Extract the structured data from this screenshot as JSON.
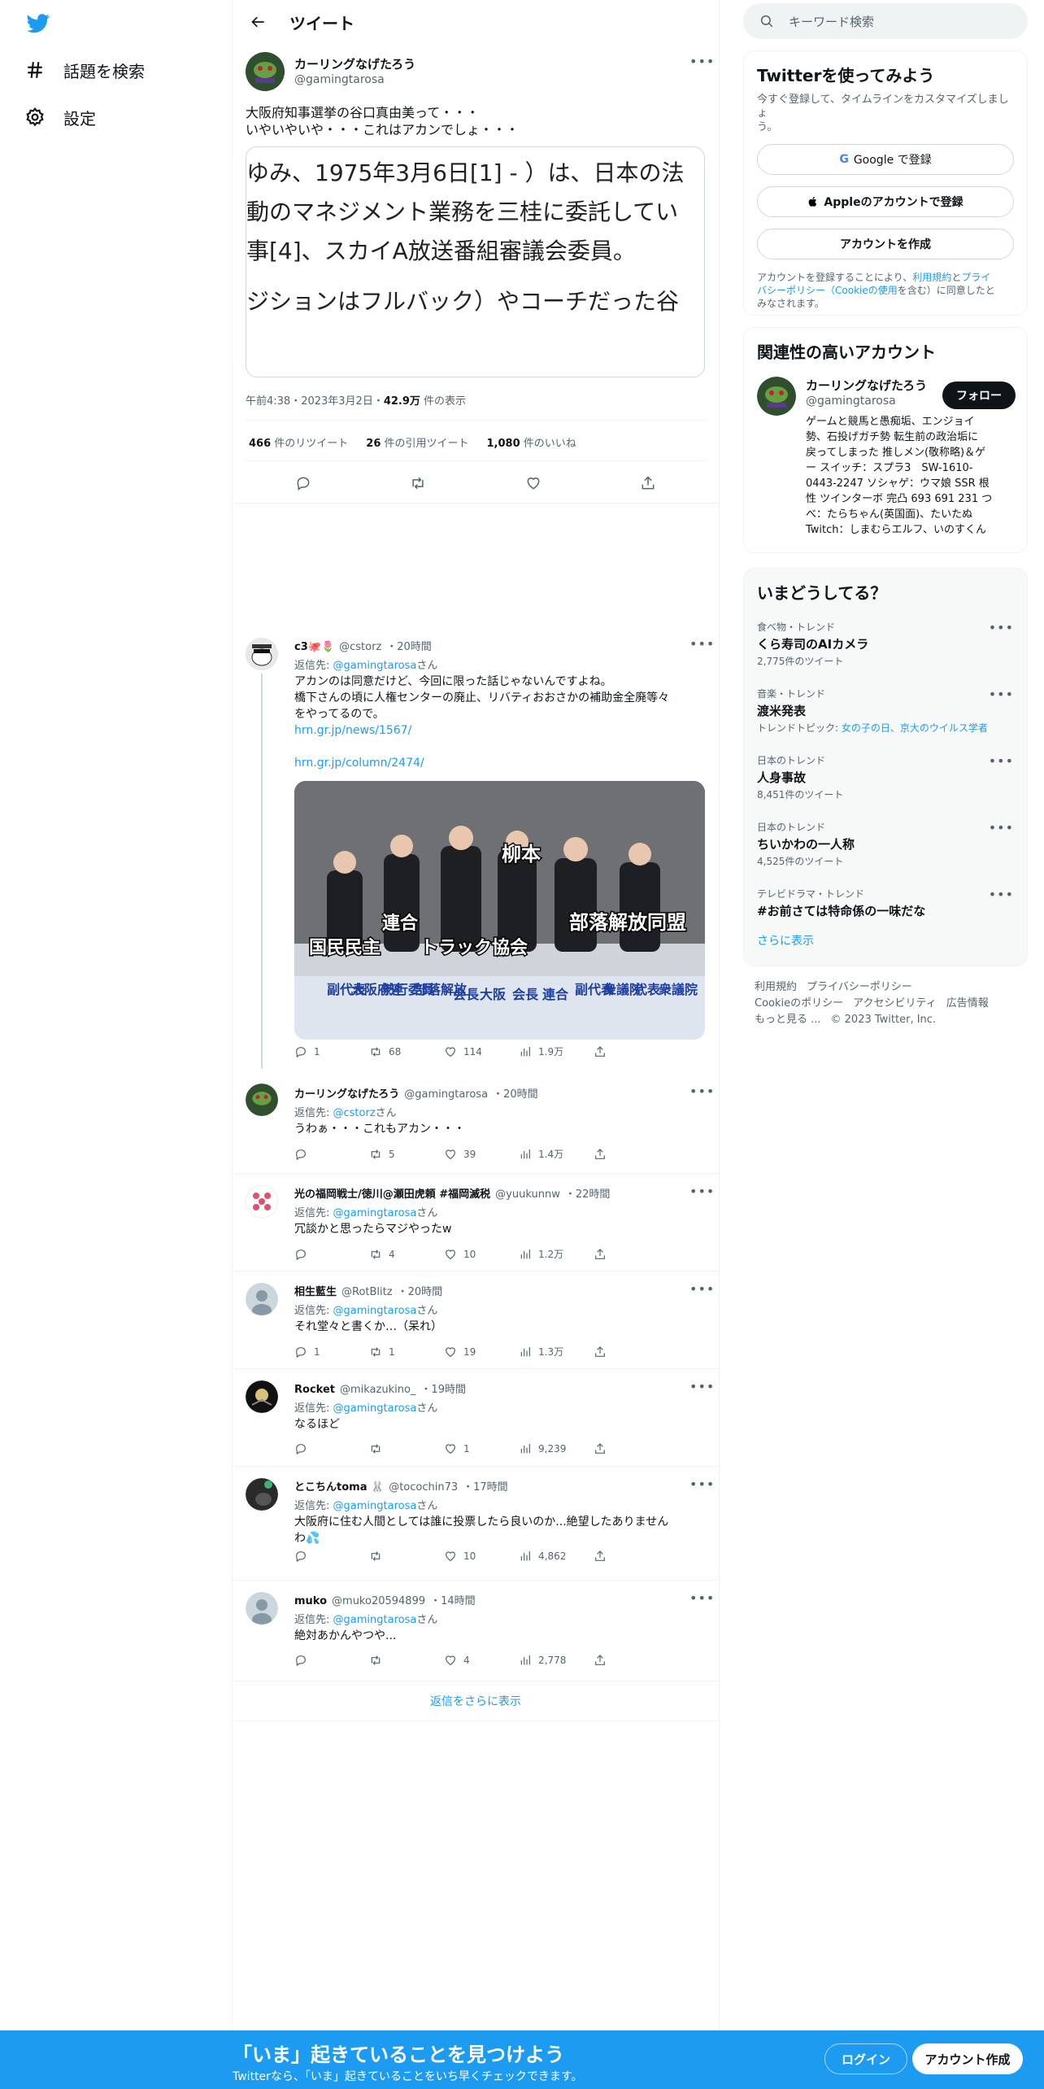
{
  "nav": {
    "explore": "話題を検索",
    "settings": "設定"
  },
  "header": {
    "title": "ツイート"
  },
  "main_tweet": {
    "name": "カーリングなげたろう",
    "handle": "@gamingtarosa",
    "text1": "大阪府知事選挙の谷口真由美って・・・",
    "text2": "いやいやいや・・・これはアカンでしょ・・・",
    "image_lines": [
      "ゆみ、1975年3月6日[1] - ）は、日本の法",
      "動のマネジメント業務を三桂に委託してい",
      "事[4]、スカイA放送番組審議会委員。",
      "ジションはフルバック）やコーチだった谷"
    ],
    "time": "午前4:38・2023年3月2日・",
    "views": "42.9万",
    "views_label": " 件の表示",
    "retweets": "466",
    "retweets_label": " 件のリツイート",
    "quotes": "26",
    "quotes_label": " 件の引用ツイート",
    "likes": "1,080",
    "likes_label": " 件のいいね"
  },
  "replies": [
    {
      "name": "c3🐙🌷",
      "handle": "@cstorz",
      "time": "・20時間",
      "to_label": "返信先: ",
      "to": "@gamingtarosa",
      "to_suffix": "さん",
      "lines": [
        "アカンのは同意だけど、今回に限った話じゃないんですよね。",
        "橋下さんの頃に人権センターの廃止、リバティおおさかの補助金全廃等々",
        "をやってるので。"
      ],
      "link1": "hrn.gr.jp/news/1567/",
      "link2": "hrn.gr.jp/column/2474/",
      "image_labels": [
        "柳本",
        "連合",
        "部落解放同盟",
        "国民民主",
        "トラック協会"
      ],
      "sign_texts": [
        "副代表",
        "大阪府連",
        "熱行委員",
        "部落解放",
        "会長",
        "大阪",
        "会長",
        "連合",
        "副代表",
        "衆議院",
        "代表",
        "衆議院"
      ],
      "reply_count": "1",
      "rt": "68",
      "like": "114",
      "views": "1.9万"
    },
    {
      "name": "カーリングなげたろう",
      "handle": "@gamingtarosa",
      "time": "・20時間",
      "to_label": "返信先: ",
      "to": "@cstorz",
      "to_suffix": "さん",
      "text": "うわぁ・・・これもアカン・・・",
      "reply_count": "",
      "rt": "5",
      "like": "39",
      "views": "1.4万"
    },
    {
      "name": "光の福岡戦士/徳川@瀬田虎頼 #福岡滅税",
      "handle": "@yuukunnw",
      "time": "・22時間",
      "to_label": "返信先: ",
      "to": "@gamingtarosa",
      "to_suffix": "さん",
      "text": "冗談かと思ったらマジやったw",
      "reply_count": "",
      "rt": "4",
      "like": "10",
      "views": "1.2万"
    },
    {
      "name": "相生藍生",
      "handle": "@RotBlitz",
      "time": "・20時間",
      "to_label": "返信先: ",
      "to": "@gamingtarosa",
      "to_suffix": "さん",
      "text": "それ堂々と書くか…（呆れ）",
      "reply_count": "1",
      "rt": "1",
      "like": "19",
      "views": "1.3万"
    },
    {
      "name": "Rocket",
      "handle": "@mikazukino_",
      "time": "・19時間",
      "to_label": "返信先: ",
      "to": "@gamingtarosa",
      "to_suffix": "さん",
      "text": "なるほど",
      "reply_count": "",
      "rt": "",
      "like": "1",
      "views": "9,239"
    },
    {
      "name": "とこちんtoma 🐰",
      "handle": "@tocochin73",
      "time": "・17時間",
      "to_label": "返信先: ",
      "to": "@gamingtarosa",
      "to_suffix": "さん",
      "text": "大阪府に住む人間としては誰に投票したら良いのか...絶望したありません",
      "text2": "わ💦",
      "reply_count": "",
      "rt": "",
      "like": "10",
      "views": "4,862"
    },
    {
      "name": "muko",
      "handle": "@muko20594899",
      "time": "・14時間",
      "to_label": "返信先: ",
      "to": "@gamingtarosa",
      "to_suffix": "さん",
      "text": "絶対あかんやつや...",
      "reply_count": "",
      "rt": "",
      "like": "4",
      "views": "2,778"
    }
  ],
  "show_more": "返信をさらに表示",
  "search": {
    "placeholder": "キーワード検索"
  },
  "signup": {
    "title": "Twitterを使ってみよう",
    "sub1": "今すぐ登録して、タイムラインをカスタマイズしましょ",
    "sub2": "う。",
    "google": "Google で登録",
    "apple": "Appleのアカウントで登録",
    "create": "アカウントを作成",
    "terms1": "アカウントを登録することにより、",
    "terms_link1": "利用規約",
    "terms2": "と",
    "terms_link2": "プライ",
    "terms3": "バシーポリシー（Cookieの使用",
    "terms4": "を含む）に同意したと",
    "terms5": "みなされます。"
  },
  "related": {
    "title": "関連性の高いアカウント",
    "name": "カーリングなげたろう",
    "handle": "@gamingtarosa",
    "follow": "フォロー",
    "bio": [
      "ゲームと競馬と愚痴垢、エンジョイ",
      "勢、石投げガチ勢 転生前の政治垢に",
      "戻ってしまった 推しメン(敬称略)＆ゲ",
      "ー スイッチ：スプラ3　SW-1610-",
      "0443-2247 ソシャゲ：ウマ娘 SSR 根",
      "性 ツインターボ 完凸 693 691 231 つ",
      "べ：たらちゃん(英国面)、たいたぬ",
      "Twitch：しまむらエルフ、いのすくん"
    ]
  },
  "trends": {
    "title": "いまどうしてる？",
    "items": [
      {
        "cat": "食べ物・トレンド",
        "title": "くら寿司のAIカメラ",
        "count": "2,775件のツイート"
      },
      {
        "cat": "音楽・トレンド",
        "title": "渡米発表",
        "count": "トレンドトピック: ",
        "topic": "女の子の日、京大のウイルス学者"
      },
      {
        "cat": "日本のトレンド",
        "title": "人身事故",
        "count": "8,451件のツイート"
      },
      {
        "cat": "日本のトレンド",
        "title": "ちいかわの一人称",
        "count": "4,525件のツイート"
      },
      {
        "cat": "テレビドラマ・トレンド",
        "title": "#お前さては特命係の一味だな",
        "count": ""
      }
    ],
    "more": "さらに表示"
  },
  "footer": {
    "l1a": "利用規約",
    "l1b": "プライバシーポリシー",
    "l2a": "Cookieのポリシー",
    "l2b": "アクセシビリティ",
    "l2c": "広告情報",
    "l3a": "もっと見る ...",
    "l3b": "© 2023 Twitter, Inc."
  },
  "bottom": {
    "title": "「いま」起きていることを見つけよう",
    "sub": "Twitterなら、「いま」起きていることをいち早くチェックできます。",
    "login": "ログイン",
    "signup": "アカウント作成"
  },
  "colors": {
    "brand": "#1d9bf0",
    "link": "#1d9bf0"
  }
}
